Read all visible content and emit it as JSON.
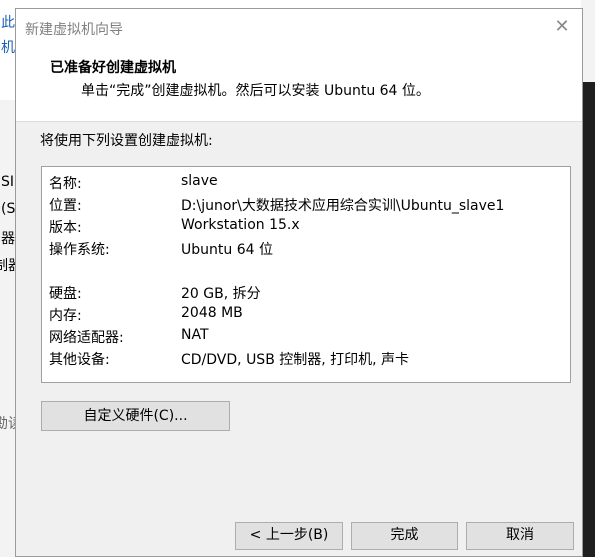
{
  "background": {
    "left_fragments": [
      "此",
      "机",
      "SI)",
      "(S",
      "器",
      "制器",
      "勘读"
    ],
    "accent_color": "#1a5fb4"
  },
  "dialog": {
    "title": "新建虚拟机向导",
    "close_icon": "close-icon",
    "header": {
      "title": "已准备好创建虚拟机",
      "subtitle": "单击“完成”创建虚拟机。然后可以安装 Ubuntu 64 位。"
    },
    "section_label": "将使用下列设置创建虚拟机:",
    "summary": [
      {
        "label": "名称:",
        "value": "slave"
      },
      {
        "label": "位置:",
        "value": "D:\\junor\\大数据技术应用综合实训\\Ubuntu_slave1"
      },
      {
        "label": "版本:",
        "value": "Workstation 15.x"
      },
      {
        "label": "操作系统:",
        "value": "Ubuntu 64 位"
      },
      {
        "label": "硬盘:",
        "value": "20 GB, 拆分"
      },
      {
        "label": "内存:",
        "value": "2048 MB"
      },
      {
        "label": "网络适配器:",
        "value": "NAT"
      },
      {
        "label": "其他设备:",
        "value": "CD/DVD, USB 控制器, 打印机, 声卡"
      }
    ],
    "buttons": {
      "customize_hardware": "自定义硬件(C)...",
      "back": "< 上一步(B)",
      "finish": "完成",
      "cancel": "取消"
    }
  }
}
